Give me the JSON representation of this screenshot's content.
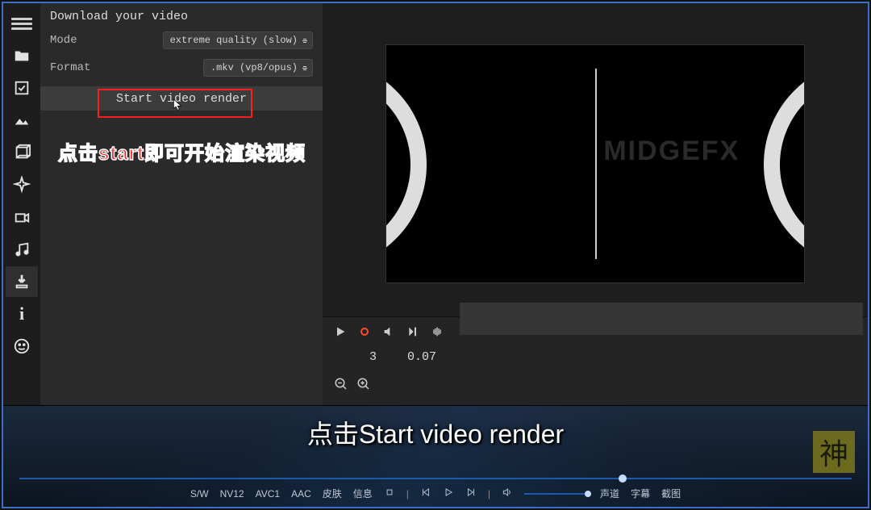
{
  "panel": {
    "title": "Download your video",
    "mode_label": "Mode",
    "mode_value": "extreme quality (slow)",
    "format_label": "Format",
    "format_value": ".mkv (vp8/opus)",
    "start_button": "Start video render"
  },
  "annotation": {
    "red_text": "点击start即可开始渲染视频"
  },
  "preview": {
    "watermark_text": "MIDGEFX"
  },
  "playback": {
    "frame_number": "3",
    "time_value": "0.07"
  },
  "subtitle": "点击Start video render",
  "player_labels": {
    "sw": "S/W",
    "nv12": "NV12",
    "avc1": "AVC1",
    "aac": "AAC",
    "skin": "皮肤",
    "info": "信息",
    "audio": "声道",
    "sub": "字幕",
    "screenshot": "截图"
  },
  "corner_mark": "神"
}
